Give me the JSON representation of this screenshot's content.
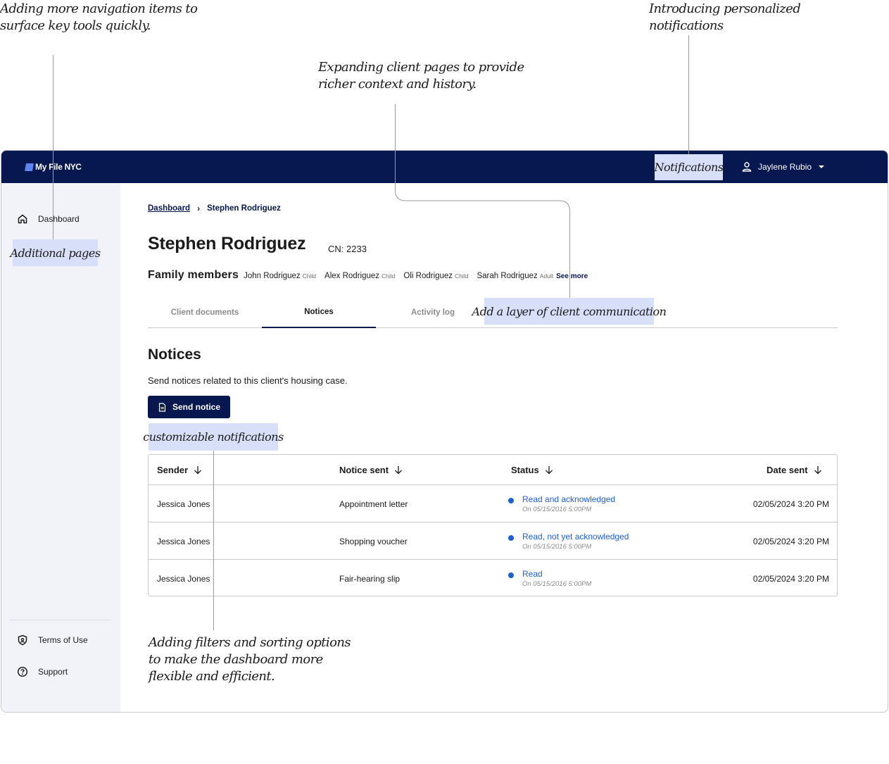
{
  "annotations": {
    "nav_items": "Adding more navigation items to\nsurface key tools quickly.",
    "client_pages": "Expanding client pages to provide\nricher context and history.",
    "notifications": "Introducing personalized\nnotifications",
    "filters": "Adding filters and sorting options\nto make the dashboard more\nflexible and efficient."
  },
  "highlights": {
    "notifications": "Notifications",
    "additional_pages": "Additional pages",
    "client_communication": "Add a layer of client communication",
    "customizable": "customizable notifications"
  },
  "header": {
    "logo_text_1": "My File",
    "logo_text_2": "NYC",
    "user_name": "Jaylene Rubio"
  },
  "sidebar": {
    "items": [
      {
        "label": "Dashboard",
        "icon": "home-icon"
      },
      {
        "label": "Terms of Use",
        "icon": "shield-icon"
      },
      {
        "label": "Support",
        "icon": "help-icon"
      }
    ]
  },
  "breadcrumb": {
    "parent": "Dashboard",
    "current": "Stephen Rodriguez"
  },
  "client": {
    "name": "Stephen Rodriguez",
    "case_number": "CN: 2233",
    "family_label": "Family members",
    "family": [
      {
        "name": "John Rodriguez",
        "relation": "Child"
      },
      {
        "name": "Alex Rodriguez",
        "relation": "Child"
      },
      {
        "name": "Oli Rodriguez",
        "relation": "Child"
      },
      {
        "name": "Sarah Rodriguez",
        "relation": "Adult"
      }
    ],
    "see_more": "See more"
  },
  "tabs": [
    {
      "label": "Client documents",
      "active": false
    },
    {
      "label": "Notices",
      "active": true
    },
    {
      "label": "Activity log",
      "active": false
    }
  ],
  "notices": {
    "title": "Notices",
    "description": "Send notices related to this client's housing case.",
    "send_button": "Send notice",
    "columns": [
      "Sender",
      "Notice sent",
      "Status",
      "Date sent"
    ],
    "rows": [
      {
        "sender": "Jessica Jones",
        "notice": "Appointment letter",
        "status": "Read and acknowledged",
        "status_date": "On 05/15/2016 5:00PM",
        "date": "02/05/2024 3:20 PM"
      },
      {
        "sender": "Jessica Jones",
        "notice": "Shopping voucher",
        "status": "Read, not yet acknowledged",
        "status_date": "On 05/15/2016 5:00PM",
        "date": "02/05/2024 3:20 PM"
      },
      {
        "sender": "Jessica Jones",
        "notice": "Fair-hearing slip",
        "status": "Read",
        "status_date": "On 05/15/2016 5:00PM",
        "date": "02/05/2024 3:20 PM"
      }
    ]
  },
  "colors": {
    "navy": "#071750",
    "highlight": "#d8dff8",
    "status_blue": "#1e5fd0",
    "sidebar_bg": "#f1f3f8"
  }
}
